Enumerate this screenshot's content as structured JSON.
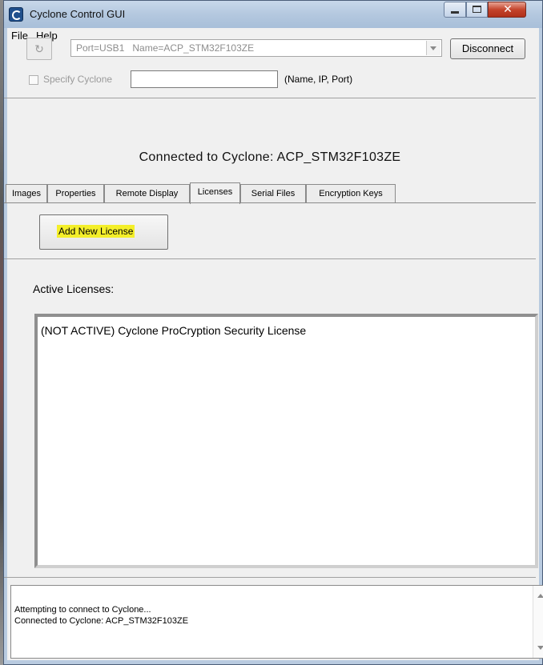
{
  "window": {
    "title": "Cyclone Control GUI"
  },
  "menu": {
    "items": [
      "File",
      "Help"
    ]
  },
  "connection": {
    "port_value": "Port=USB1   Name=ACP_STM32F103ZE",
    "disconnect_label": "Disconnect",
    "specify_label": "Specify Cyclone",
    "specify_value": "",
    "specify_hint": "(Name, IP, Port)",
    "status_banner": "Connected to Cyclone: ACP_STM32F103ZE"
  },
  "tabs": [
    {
      "label": "Images"
    },
    {
      "label": "Properties"
    },
    {
      "label": "Remote Display"
    },
    {
      "label": "Licenses",
      "active": true
    },
    {
      "label": "Serial Files"
    },
    {
      "label": "Encryption Keys"
    }
  ],
  "licenses": {
    "add_button_label": "Add New License",
    "active_heading": "Active Licenses:",
    "items": [
      "(NOT ACTIVE) Cyclone ProCryption Security License"
    ]
  },
  "log": {
    "lines": [
      "Attempting to connect to Cyclone...",
      "Connected to Cyclone: ACP_STM32F103ZE"
    ]
  },
  "colors": {
    "highlight": "#f4ef2a",
    "title_bar": "#b4c8df"
  }
}
